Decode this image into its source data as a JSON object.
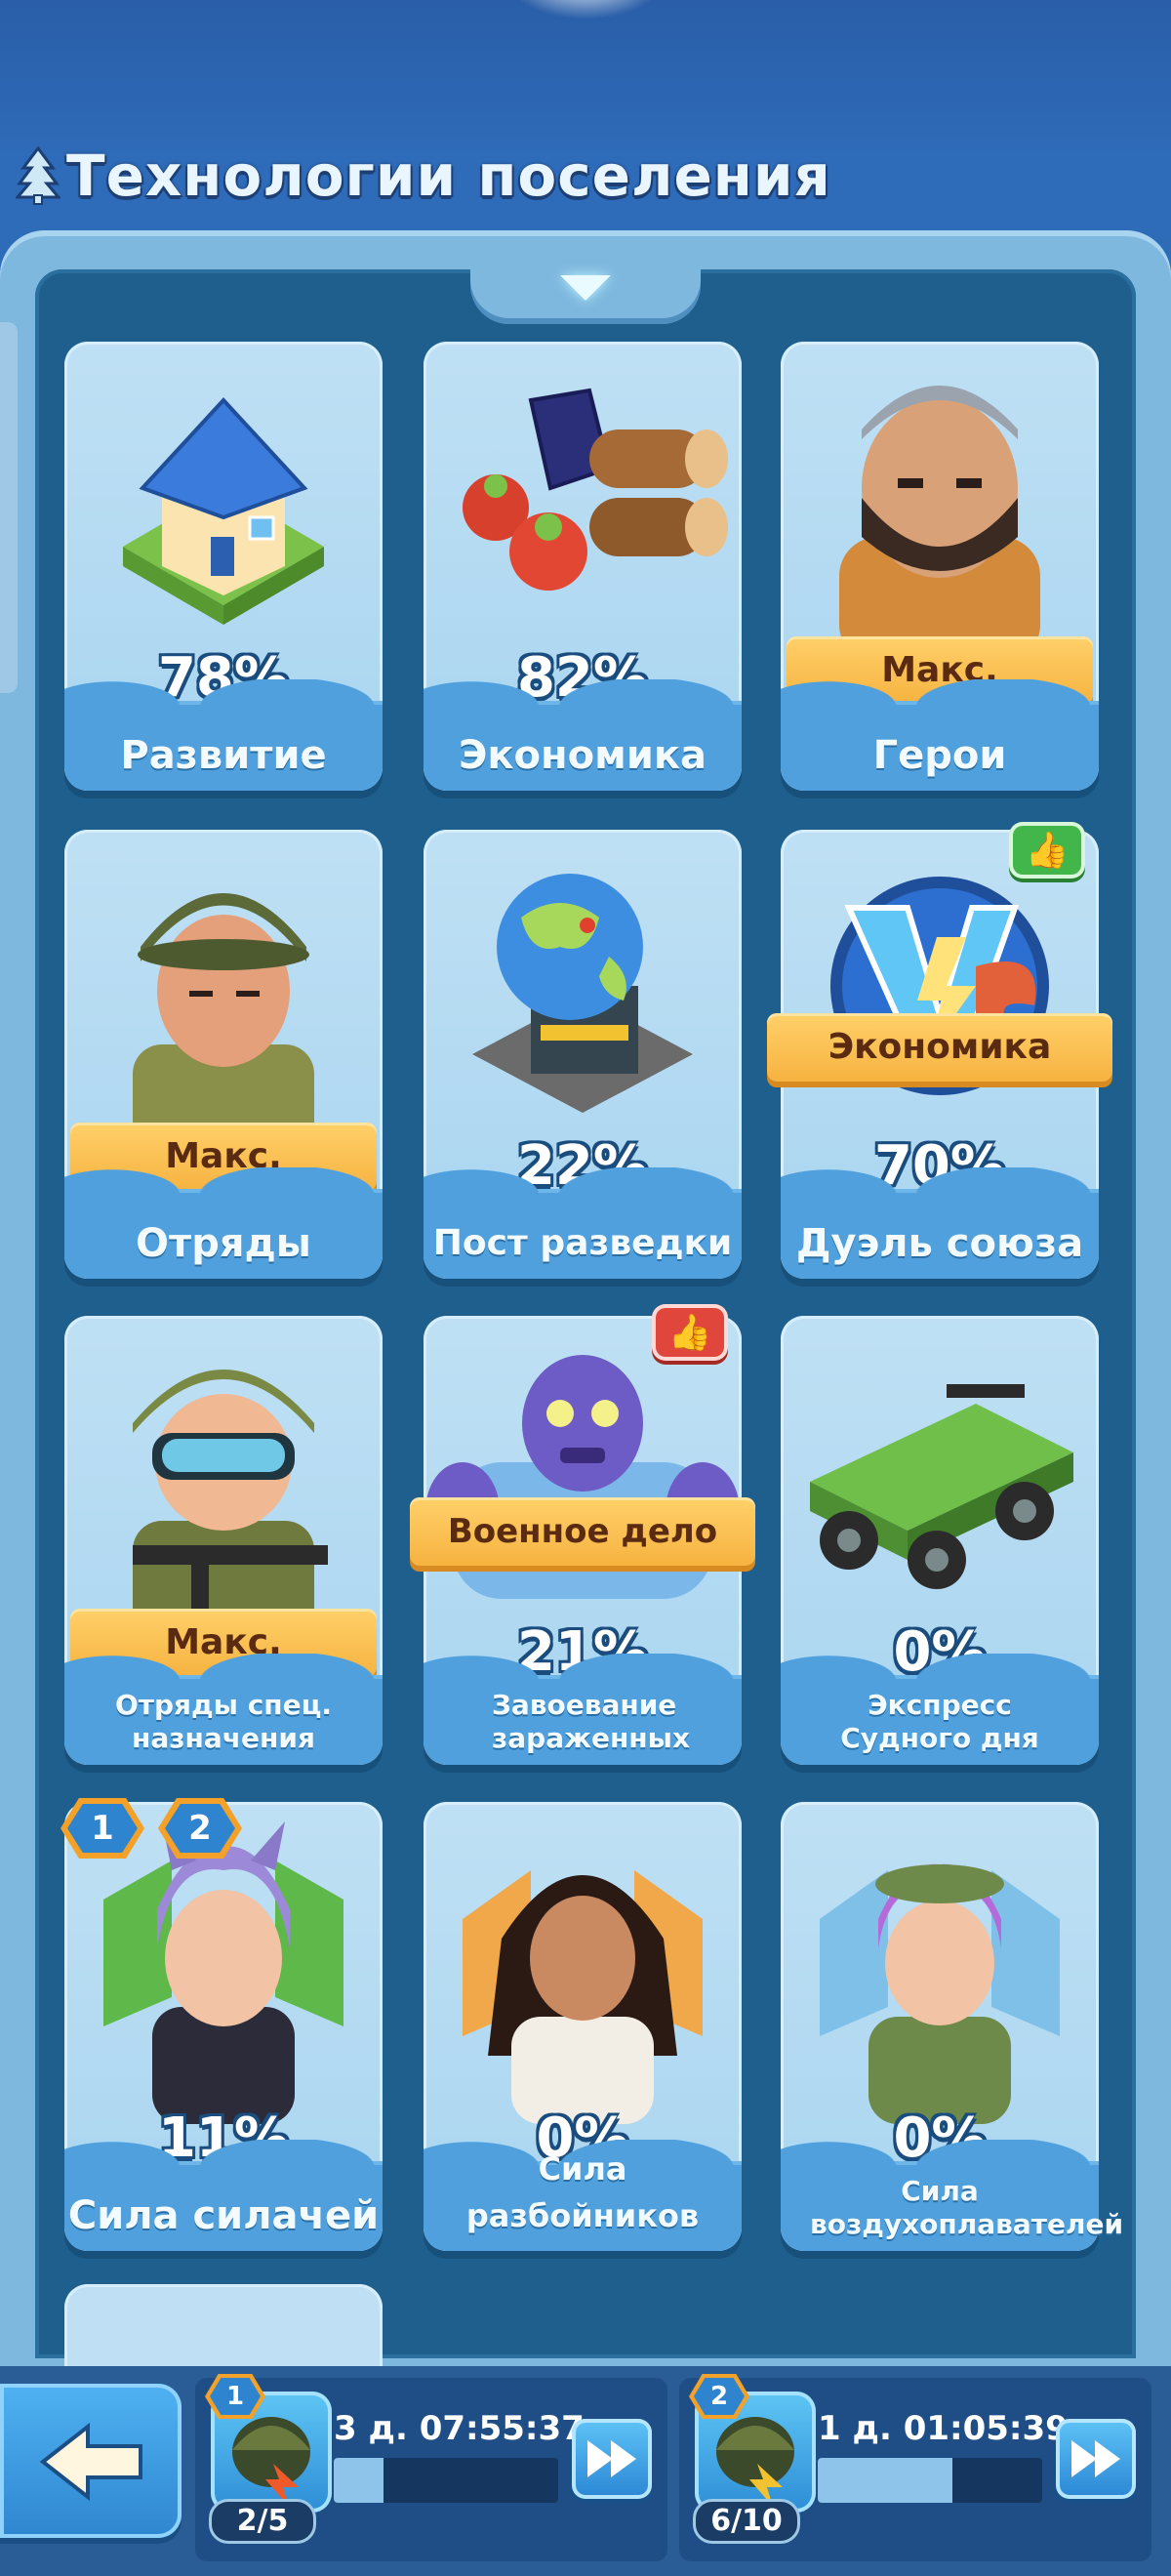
{
  "header": {
    "title": "Технологии поселения",
    "icon": "tree-icon"
  },
  "cards": [
    {
      "label": "Развитие",
      "percent": "78%",
      "art": "house-icon"
    },
    {
      "label": "Экономика",
      "percent": "82%",
      "art": "resources-icon"
    },
    {
      "label": "Герои",
      "ribbon": "Макс.",
      "art": "hero-portrait-icon"
    },
    {
      "label": "Отряды",
      "ribbon": "Макс.",
      "art": "soldier-portrait-icon"
    },
    {
      "label": "Пост разведки",
      "percent": "22%",
      "art": "globe-icon"
    },
    {
      "label": "Дуэль союза",
      "percent": "70%",
      "ribbon": "Экономика",
      "art": "versus-icon",
      "badge": "thumbs-up-icon"
    },
    {
      "label": "Отряды спец. назначения",
      "ribbon": "Макс.",
      "art": "special-soldier-icon"
    },
    {
      "label": "Завоевание зараженных",
      "percent": "21%",
      "ribbon": "Военное дело",
      "art": "zombie-icon",
      "badge": "thumbs-up-icon"
    },
    {
      "label": "Экспресс Судного дня",
      "percent": "0%",
      "art": "truck-icon"
    },
    {
      "label": "Сила силачей",
      "percent": "11%",
      "art": "brawler-hero-icon",
      "badges": [
        "1",
        "2"
      ]
    },
    {
      "label": "Сила разбойников",
      "percent": "0%",
      "art": "marksman-hero-icon"
    },
    {
      "label": "Сила воздухоплавателей",
      "percent": "0%",
      "art": "aviator-hero-icon"
    }
  ],
  "queues": [
    {
      "number": "1",
      "count": "2/5",
      "time": "3 д. 07:55:37",
      "progress": 0.22
    },
    {
      "number": "2",
      "count": "6/10",
      "time": "1 д. 01:05:39",
      "progress": 0.6
    }
  ]
}
